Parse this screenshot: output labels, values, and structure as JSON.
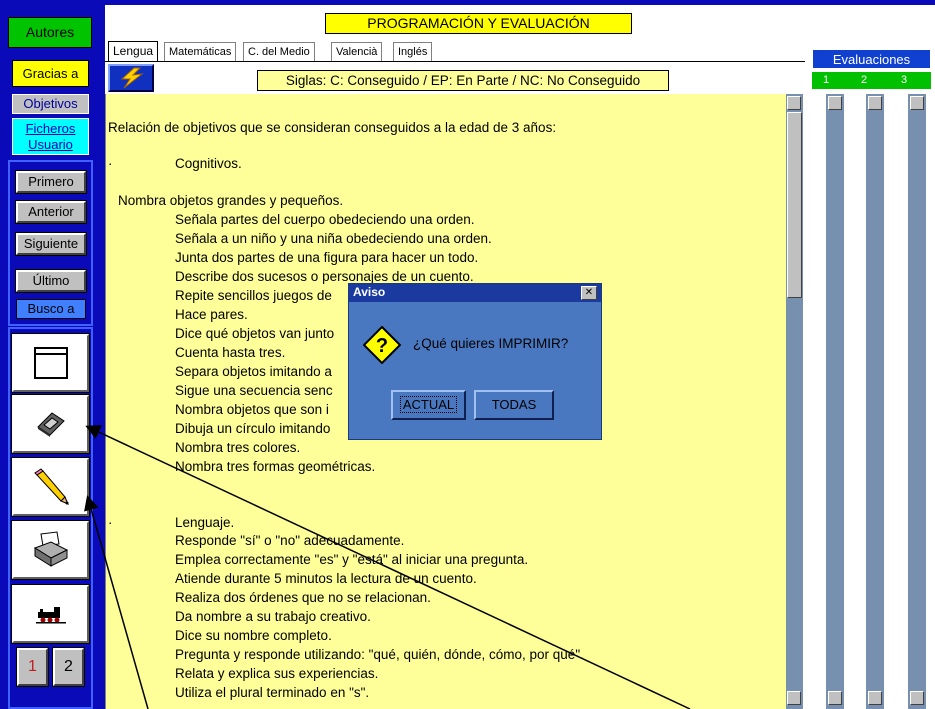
{
  "sidebar": {
    "autores": "Autores",
    "gracias": "Gracias a",
    "objetivos": "Objetivos",
    "ficheros_line1": "Ficheros",
    "ficheros_line2": "Usuario",
    "primero": "Primero",
    "anterior": "Anterior",
    "siguiente": "Siguiente",
    "ultimo": "Último",
    "busco": "Busco a",
    "icons": [
      "window-icon",
      "floppy-disk-icon",
      "pencil-icon",
      "printer-icon",
      "train-icon"
    ],
    "page1": "1",
    "page2": "2"
  },
  "header": {
    "title": "PROGRAMACIÓN Y EVALUACIÓN",
    "tabs": [
      "Lengua",
      "Matemáticas",
      "C. del Medio",
      "Valencià",
      "Inglés"
    ],
    "siglas": "Siglas: C: Conseguido / EP: En Parte / NC: No Conseguido"
  },
  "evaluaciones": {
    "label": "Evaluaciones",
    "numbers": [
      "1",
      "2",
      "3"
    ]
  },
  "content": {
    "intro": "Relación de objetivos que se consideran conseguidos a la edad de 3 años:",
    "cognitivos_bullet": "·",
    "cognitivos": "Cognitivos.",
    "first_item": "Nombra objetos grandes y pequeños.",
    "cognitive_items": [
      "Señala partes del cuerpo obedeciendo una orden.",
      "Señala a un niño y una niña obedeciendo una orden.",
      "Junta dos partes de una figura para hacer un todo.",
      "Describe dos sucesos o personajes de un cuento.",
      "Repite sencillos juegos de",
      "Hace pares.",
      "Dice qué objetos van junto",
      "Cuenta hasta tres.",
      "Separa objetos imitando a",
      "Sigue una secuencia senc",
      "Nombra objetos que son i",
      "Dibuja un círculo imitando",
      "Nombra tres colores.",
      "Nombra tres formas geométricas."
    ],
    "lenguaje_bullet": "·",
    "lenguaje": "Lenguaje.",
    "language_items": [
      "Responde \"sí\" o \"no\" adecuadamente.",
      "Emplea correctamente \"es\" y \"está\" al iniciar una pregunta.",
      "Atiende durante 5 minutos la lectura de un cuento.",
      "Realiza dos órdenes que no se relacionan.",
      "Da nombre a su trabajo creativo.",
      "Dice su nombre completo.",
      "Pregunta y responde utilizando: \"qué, quién, dónde, cómo, por qué\".",
      "Relata y explica sus experiencias.",
      "Utiliza el plural terminado en \"s\"."
    ]
  },
  "dialog": {
    "title": "Aviso",
    "close": "✕",
    "question_icon": "question-icon",
    "message": "¿Qué quieres IMPRIMIR?",
    "actual": "ACTUAL",
    "todas": "TODAS"
  }
}
